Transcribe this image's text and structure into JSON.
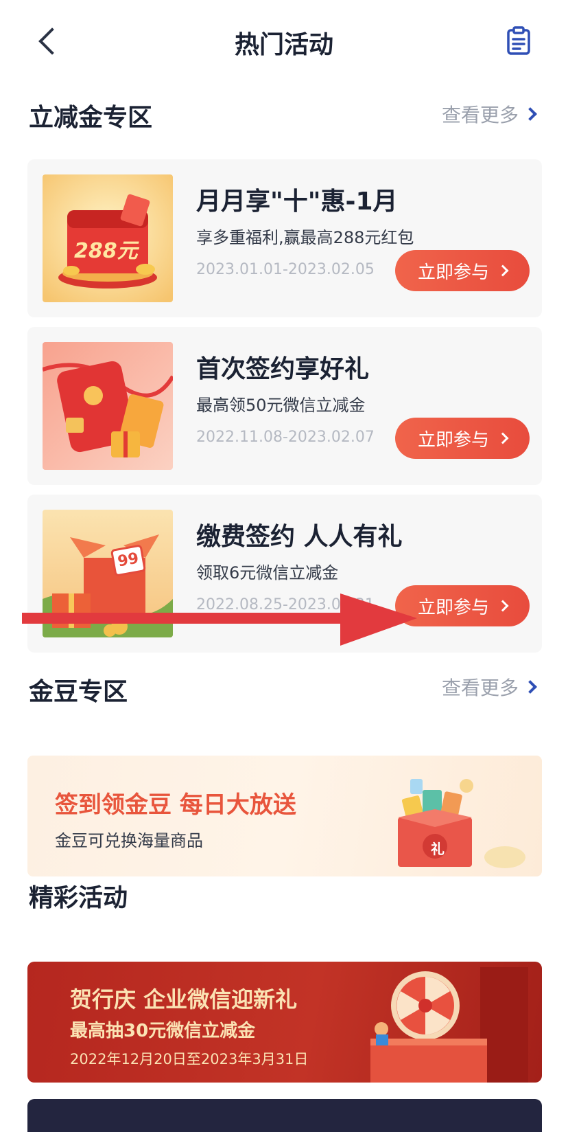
{
  "header": {
    "title": "热门活动",
    "back_icon": "chevron-left-icon",
    "doc_icon": "clipboard-icon"
  },
  "sections": {
    "discount": {
      "title": "立减金专区",
      "more": "查看更多"
    },
    "beans": {
      "title": "金豆专区",
      "more": "查看更多"
    },
    "activities": {
      "title": "精彩活动"
    }
  },
  "cards": [
    {
      "title": "月月享\"十\"惠-1月",
      "desc": "享多重福利,赢最高288元红包",
      "date": "2023.01.01-2023.02.05",
      "button": "立即参与",
      "thumb_text": "288元"
    },
    {
      "title": "首次签约享好礼",
      "desc": "最高领50元微信立减金",
      "date": "2022.11.08-2023.02.07",
      "button": "立即参与"
    },
    {
      "title": "缴费签约 人人有礼",
      "desc": "领取6元微信立减金",
      "date": "2022.08.25-2023.03.31",
      "button": "立即参与",
      "thumb_text": "99"
    }
  ],
  "bean_banner": {
    "title": "签到领金豆 每日大放送",
    "subtitle": "金豆可兑换海量商品",
    "gift_text": "礼"
  },
  "red_banner": {
    "title": "贺行庆 企业微信迎新礼",
    "subtitle": "最高抽30元微信立减金",
    "date": "2022年12月20日至2023年3月31日"
  },
  "colors": {
    "accent": "#e84c3d",
    "link_chevron": "#2f4fb5",
    "arrow": "#e23a3e"
  }
}
